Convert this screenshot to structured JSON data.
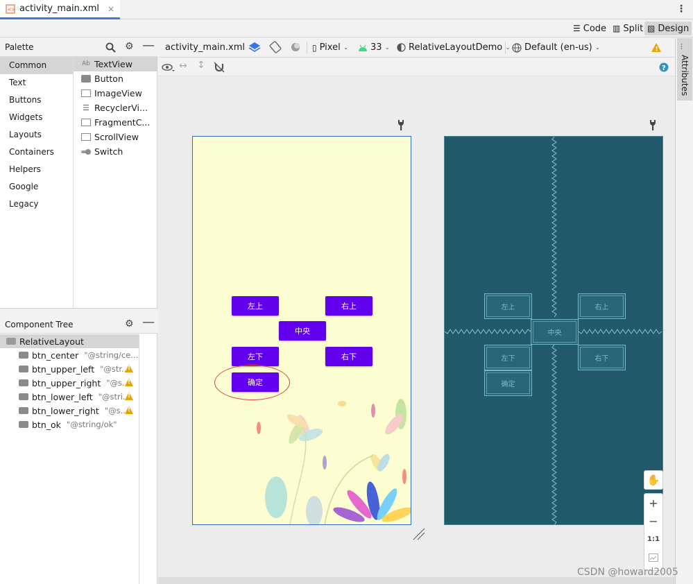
{
  "tab": {
    "file_name": "activity_main.xml",
    "close": "×"
  },
  "modes": {
    "code": "Code",
    "split": "Split",
    "design": "Design"
  },
  "palette": {
    "title": "Palette",
    "categories": [
      "Common",
      "Text",
      "Buttons",
      "Widgets",
      "Layouts",
      "Containers",
      "Helpers",
      "Google",
      "Legacy"
    ],
    "items": [
      {
        "icon": "Ab",
        "label": "TextView"
      },
      {
        "icon": "",
        "label": "Button"
      },
      {
        "icon": "",
        "label": "ImageView"
      },
      {
        "icon": "",
        "label": "RecyclerVi..."
      },
      {
        "icon": "",
        "label": "FragmentC..."
      },
      {
        "icon": "",
        "label": "ScrollView"
      },
      {
        "icon": "",
        "label": "Switch"
      }
    ]
  },
  "component_tree": {
    "title": "Component Tree",
    "root": "RelativeLayout",
    "rows": [
      {
        "id": "btn_center",
        "value": "\"@string/ce..."
      },
      {
        "id": "btn_upper_left",
        "value": "\"@str..."
      },
      {
        "id": "btn_upper_right",
        "value": "\"@s..."
      },
      {
        "id": "btn_lower_left",
        "value": "\"@stri..."
      },
      {
        "id": "btn_lower_right",
        "value": "\"@s..."
      },
      {
        "id": "btn_ok",
        "value": "\"@string/ok\""
      }
    ]
  },
  "toolbar": {
    "file": "activity_main.xml",
    "device": "Pixel",
    "api": "33",
    "theme": "RelativeLayoutDemo",
    "locale": "Default (en-us)"
  },
  "design_buttons": {
    "upper_left": "左上",
    "upper_right": "右上",
    "center": "中央",
    "lower_left": "左下",
    "lower_right": "右下",
    "ok": "确定"
  },
  "zoom": {
    "plus": "+",
    "minus": "−",
    "one_to_one": "1:1"
  },
  "right_panel": {
    "attributes": "Attributes"
  },
  "watermark": "CSDN @howard2005",
  "colors": {
    "accent": "#6200ee",
    "blueprint_bg": "#225a6b",
    "design_bg": "#fdfdd2",
    "tab_underline": "#3b7bd6"
  }
}
